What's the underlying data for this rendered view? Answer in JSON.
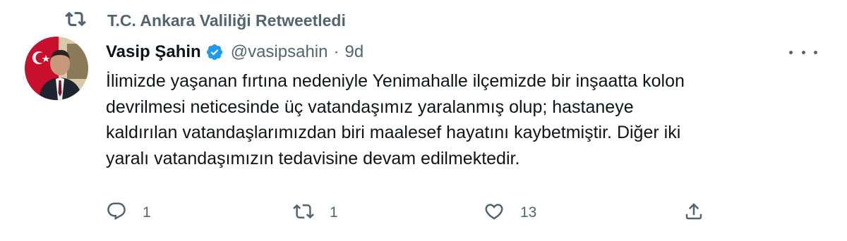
{
  "retweet": {
    "label": "T.C. Ankara Valiliği Retweetledi",
    "icon": "retweet-icon"
  },
  "author": {
    "display_name": "Vasip Şahin",
    "verified": true,
    "handle": "@vasipsahin",
    "separator": "·",
    "time": "9d",
    "avatar": "avatar-photo"
  },
  "tweet": {
    "lines": [
      "İlimizde yaşanan fırtına nedeniyle Yenimahalle ilçemizde bir inşaatta kolon",
      "devrilmesi neticesinde üç vatandaşımız yaralanmış olup; hastaneye",
      "kaldırılan vatandaşlarımızdan biri maalesef hayatını kaybetmiştir. Diğer iki",
      "yaralı vatandaşımızın tedavisine devam edilmektedir."
    ]
  },
  "actions": {
    "reply_count": "1",
    "retweet_count": "1",
    "like_count": "13"
  },
  "colors": {
    "text": "#0f1419",
    "muted": "#536471",
    "verified": "#1d9bf0"
  }
}
